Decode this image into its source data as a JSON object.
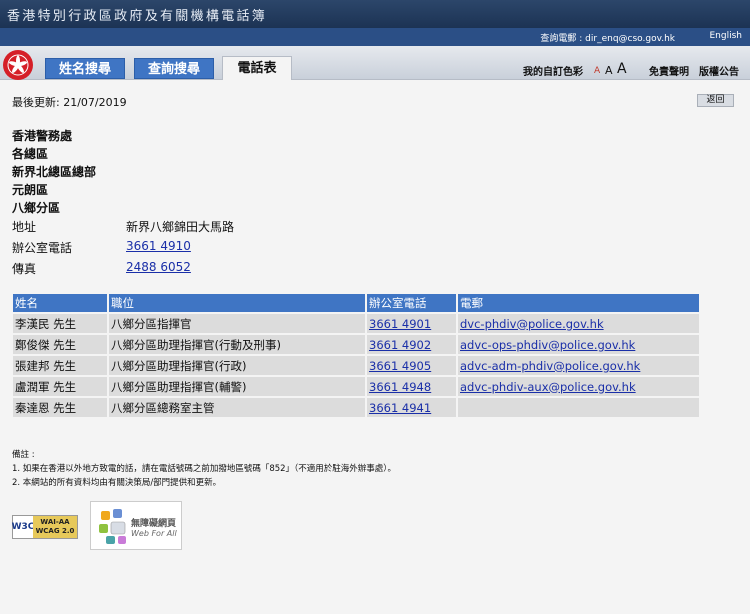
{
  "header": {
    "site_title": "香港特別行政區政府及有關機構電話簿",
    "enquiry": "查詢電郵 : dir_enq@cso.gov.hk",
    "english_link": "English",
    "tabs": [
      {
        "label": "姓名搜尋"
      },
      {
        "label": "查詢搜尋"
      },
      {
        "label": "電話表"
      }
    ],
    "color_scheme": "我的自訂色彩",
    "font_sizes": [
      "A",
      "A",
      "A"
    ],
    "disclaimer": "免責聲明",
    "copyright": "版權公告"
  },
  "last_updated": "最後更新: 21/07/2019",
  "back_button": "返回",
  "organisation": [
    "香港警務處",
    "各總區",
    "新界北總區總部",
    "元朗區",
    "八鄉分區"
  ],
  "info": {
    "address_label": "地址",
    "address_value": "新界八鄉錦田大馬路",
    "office_tel_label": "辦公室電話",
    "office_tel_value": "3661 4910",
    "fax_label": "傳真",
    "fax_value": "2488 6052"
  },
  "table": {
    "headers": [
      "姓名",
      "職位",
      "辦公室電話",
      "電郵"
    ],
    "rows": [
      {
        "name": "李漢民 先生",
        "post": "八鄉分區指揮官",
        "tel": "3661 4901",
        "email": "dvc-phdiv@police.gov.hk"
      },
      {
        "name": "鄭俊傑 先生",
        "post": "八鄉分區助理指揮官(行動及刑事)",
        "tel": "3661 4902",
        "email": "advc-ops-phdiv@police.gov.hk"
      },
      {
        "name": "張建邦 先生",
        "post": "八鄉分區助理指揮官(行政)",
        "tel": "3661 4905",
        "email": "advc-adm-phdiv@police.gov.hk"
      },
      {
        "name": "盧潤軍 先生",
        "post": "八鄉分區助理指揮官(輔警)",
        "tel": "3661 4948",
        "email": "advc-phdiv-aux@police.gov.hk"
      },
      {
        "name": "秦達恩 先生",
        "post": "八鄉分區總務室主管",
        "tel": "3661 4941",
        "email": ""
      }
    ]
  },
  "notes": {
    "title": "備註 :",
    "items": [
      "1. 如果在香港以外地方致電的話，請在電話號碼之前加撥地區號碼「852」（不適用於駐海外辦事處）。",
      "2. 本網站的所有資料均由有關決策局/部門提供和更新。"
    ]
  },
  "badges": {
    "w3c_left": "W3C",
    "w3c_line1": "WAI-AA",
    "w3c_line2": "WCAG 2.0",
    "webforall_cn": "無障礙網頁",
    "webforall_en": "Web For All"
  }
}
